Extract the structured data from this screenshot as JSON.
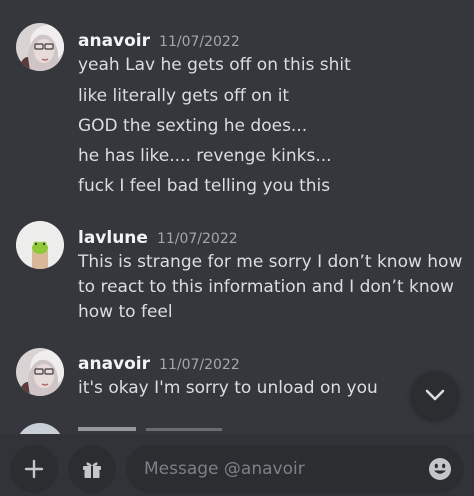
{
  "conversation": {
    "messages": [
      {
        "author": "anavoir",
        "timestamp": "11/07/2022",
        "lines": [
          "yeah Lav he gets off on this shit",
          "like literally gets off on it",
          "GOD the sexting he does...",
          "he has like.... revenge kinks...",
          "fuck I feel bad telling you this"
        ]
      },
      {
        "author": "lavlune",
        "timestamp": "11/07/2022",
        "lines": [
          "This is strange for me sorry I don’t know how",
          "to react to this information and I don’t know",
          "how to feel"
        ]
      },
      {
        "author": "anavoir",
        "timestamp": "11/07/2022",
        "lines": [
          "it's okay I'm sorry to unload on you"
        ]
      }
    ]
  },
  "composer": {
    "placeholder": "Message @anavoir",
    "add_icon": "plus-icon",
    "gift_icon": "gift-icon",
    "emoji_icon": "emoji-icon"
  },
  "scroll_button": {
    "icon": "chevron-down-icon"
  },
  "colors": {
    "background": "#36373d",
    "input_bar": "#313338",
    "button_bg": "#2b2d31",
    "text": "#dcdde1",
    "username": "#f2f3f5",
    "timestamp": "#a3a6aa",
    "placeholder": "#7d8088"
  }
}
